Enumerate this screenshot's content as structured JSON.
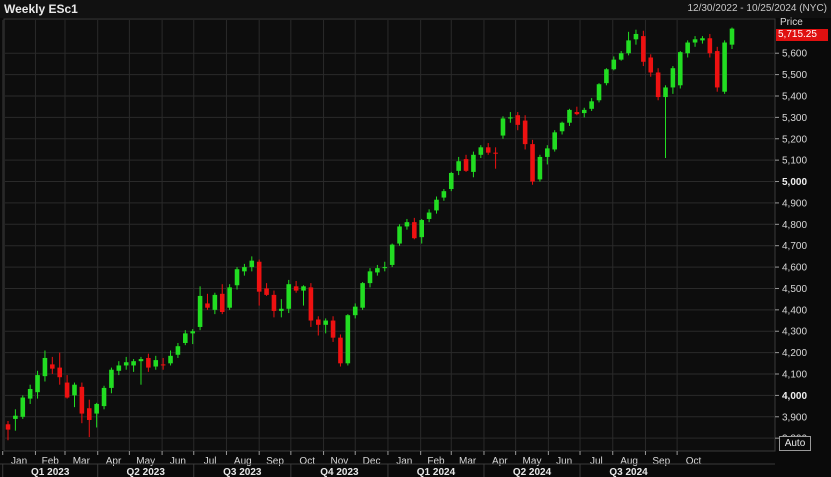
{
  "header": {
    "title": "Weekly ESc1",
    "date_range": "12/30/2022 - 10/25/2024 (NYC)"
  },
  "price_axis": {
    "label": "Price",
    "last_price": "5,715.25",
    "auto_label": "Auto"
  },
  "colors": {
    "up": "#22dd22",
    "down": "#ee1111",
    "background": "#0a0a0a",
    "grid": "#2a2a2a",
    "last_price_bg": "#e01010"
  },
  "chart_data": {
    "type": "candlestick",
    "title": "Weekly ESc1",
    "x_range": [
      "2022-12-30",
      "2024-10-25"
    ],
    "ylim": [
      3740,
      5760
    ],
    "y_ticks": [
      3800,
      3900,
      4000,
      4100,
      4200,
      4300,
      4400,
      4500,
      4600,
      4700,
      4800,
      4900,
      5000,
      5100,
      5200,
      5300,
      5400,
      5500,
      5600
    ],
    "y_tick_labels": [
      "3,800",
      "3,900",
      "4,000",
      "4,100",
      "4,200",
      "4,300",
      "4,400",
      "4,500",
      "4,600",
      "4,700",
      "4,800",
      "4,900",
      "5,000",
      "5,100",
      "5,200",
      "5,300",
      "5,400",
      "5,500",
      "5,600"
    ],
    "y_tick_labels_bold": [
      "4,000",
      "5,000"
    ],
    "grid": true,
    "month_labels": [
      "Jan",
      "Feb",
      "Mar",
      "Apr",
      "May",
      "Jun",
      "Jul",
      "Aug",
      "Sep",
      "Oct",
      "Nov",
      "Dec",
      "Jan",
      "Feb",
      "Mar",
      "Apr",
      "May",
      "Jun",
      "Jul",
      "Aug",
      "Sep",
      "Oct"
    ],
    "quarter_labels": [
      "Q1 2023",
      "Q2 2023",
      "Q3 2023",
      "Q4 2023",
      "Q1 2024",
      "Q2 2024",
      "Q3 2024"
    ],
    "candles": [
      {
        "week": "2023-01-06",
        "open": 3865,
        "high": 3880,
        "low": 3790,
        "close": 3840
      },
      {
        "week": "2023-01-13",
        "open": 3890,
        "high": 3935,
        "low": 3835,
        "close": 3905
      },
      {
        "week": "2023-01-20",
        "open": 3900,
        "high": 4000,
        "low": 3890,
        "close": 3990
      },
      {
        "week": "2023-01-27",
        "open": 3985,
        "high": 4050,
        "low": 3960,
        "close": 4030
      },
      {
        "week": "2023-02-03",
        "open": 4015,
        "high": 4115,
        "low": 3985,
        "close": 4095
      },
      {
        "week": "2023-02-10",
        "open": 4090,
        "high": 4210,
        "low": 4065,
        "close": 4175
      },
      {
        "week": "2023-02-17",
        "open": 4145,
        "high": 4180,
        "low": 4100,
        "close": 4125
      },
      {
        "week": "2023-02-24",
        "open": 4130,
        "high": 4200,
        "low": 4050,
        "close": 4085
      },
      {
        "week": "2023-03-03",
        "open": 4060,
        "high": 4095,
        "low": 3985,
        "close": 3990
      },
      {
        "week": "2023-03-10",
        "open": 4000,
        "high": 4060,
        "low": 3945,
        "close": 4050
      },
      {
        "week": "2023-03-17",
        "open": 4040,
        "high": 4060,
        "low": 3870,
        "close": 3915
      },
      {
        "week": "2023-03-24",
        "open": 3940,
        "high": 3980,
        "low": 3805,
        "close": 3885
      },
      {
        "week": "2023-03-31",
        "open": 3915,
        "high": 3965,
        "low": 3850,
        "close": 3960
      },
      {
        "week": "2023-04-07",
        "open": 3950,
        "high": 4045,
        "low": 3935,
        "close": 4035
      },
      {
        "week": "2023-04-14",
        "open": 4035,
        "high": 4130,
        "low": 4010,
        "close": 4120
      },
      {
        "week": "2023-04-21",
        "open": 4115,
        "high": 4160,
        "low": 4095,
        "close": 4140
      },
      {
        "week": "2023-04-28",
        "open": 4140,
        "high": 4180,
        "low": 4120,
        "close": 4155
      },
      {
        "week": "2023-05-05",
        "open": 4140,
        "high": 4170,
        "low": 4110,
        "close": 4160
      },
      {
        "week": "2023-05-12",
        "open": 4160,
        "high": 4180,
        "low": 4050,
        "close": 4170
      },
      {
        "week": "2023-05-19",
        "open": 4175,
        "high": 4195,
        "low": 4110,
        "close": 4130
      },
      {
        "week": "2023-05-26",
        "open": 4135,
        "high": 4185,
        "low": 4120,
        "close": 4165
      },
      {
        "week": "2023-06-02",
        "open": 4145,
        "high": 4175,
        "low": 4120,
        "close": 4140
      },
      {
        "week": "2023-06-09",
        "open": 4150,
        "high": 4210,
        "low": 4140,
        "close": 4185
      },
      {
        "week": "2023-06-16",
        "open": 4190,
        "high": 4245,
        "low": 4175,
        "close": 4230
      },
      {
        "week": "2023-06-23",
        "open": 4245,
        "high": 4305,
        "low": 4235,
        "close": 4290
      },
      {
        "week": "2023-06-30",
        "open": 4290,
        "high": 4310,
        "low": 4240,
        "close": 4300
      },
      {
        "week": "2023-07-07",
        "open": 4320,
        "high": 4510,
        "low": 4305,
        "close": 4465
      },
      {
        "week": "2023-07-14",
        "open": 4430,
        "high": 4475,
        "low": 4400,
        "close": 4410
      },
      {
        "week": "2023-07-21",
        "open": 4400,
        "high": 4480,
        "low": 4380,
        "close": 4470
      },
      {
        "week": "2023-07-28",
        "open": 4475,
        "high": 4520,
        "low": 4380,
        "close": 4390
      },
      {
        "week": "2023-08-04",
        "open": 4410,
        "high": 4520,
        "low": 4400,
        "close": 4505
      },
      {
        "week": "2023-08-11",
        "open": 4515,
        "high": 4600,
        "low": 4495,
        "close": 4590
      },
      {
        "week": "2023-08-18",
        "open": 4580,
        "high": 4615,
        "low": 4560,
        "close": 4600
      },
      {
        "week": "2023-08-25",
        "open": 4600,
        "high": 4650,
        "low": 4580,
        "close": 4630
      },
      {
        "week": "2023-09-01",
        "open": 4625,
        "high": 4635,
        "low": 4420,
        "close": 4485
      },
      {
        "week": "2023-09-08",
        "open": 4500,
        "high": 4525,
        "low": 4465,
        "close": 4470
      },
      {
        "week": "2023-09-15",
        "open": 4470,
        "high": 4490,
        "low": 4365,
        "close": 4395
      },
      {
        "week": "2023-09-22",
        "open": 4395,
        "high": 4450,
        "low": 4365,
        "close": 4405
      },
      {
        "week": "2023-09-29",
        "open": 4405,
        "high": 4540,
        "low": 4385,
        "close": 4520
      },
      {
        "week": "2023-10-06",
        "open": 4510,
        "high": 4535,
        "low": 4480,
        "close": 4490
      },
      {
        "week": "2023-10-13",
        "open": 4490,
        "high": 4515,
        "low": 4420,
        "close": 4510
      },
      {
        "week": "2023-10-20",
        "open": 4505,
        "high": 4525,
        "low": 4320,
        "close": 4350
      },
      {
        "week": "2023-10-27",
        "open": 4355,
        "high": 4370,
        "low": 4280,
        "close": 4330
      },
      {
        "week": "2023-11-03",
        "open": 4330,
        "high": 4360,
        "low": 4290,
        "close": 4350
      },
      {
        "week": "2023-11-10",
        "open": 4350,
        "high": 4370,
        "low": 4250,
        "close": 4270
      },
      {
        "week": "2023-11-17",
        "open": 4270,
        "high": 4285,
        "low": 4135,
        "close": 4150
      },
      {
        "week": "2023-11-24",
        "open": 4150,
        "high": 4380,
        "low": 4140,
        "close": 4375
      },
      {
        "week": "2023-12-01",
        "open": 4375,
        "high": 4430,
        "low": 4360,
        "close": 4415
      },
      {
        "week": "2023-12-08",
        "open": 4410,
        "high": 4530,
        "low": 4400,
        "close": 4525
      },
      {
        "week": "2023-12-15",
        "open": 4525,
        "high": 4595,
        "low": 4505,
        "close": 4580
      },
      {
        "week": "2023-12-22",
        "open": 4575,
        "high": 4610,
        "low": 4560,
        "close": 4595
      },
      {
        "week": "2023-12-29",
        "open": 4595,
        "high": 4625,
        "low": 4580,
        "close": 4600
      },
      {
        "week": "2024-01-05",
        "open": 4610,
        "high": 4710,
        "low": 4600,
        "close": 4705
      },
      {
        "week": "2024-01-12",
        "open": 4710,
        "high": 4800,
        "low": 4700,
        "close": 4790
      },
      {
        "week": "2024-01-19",
        "open": 4790,
        "high": 4825,
        "low": 4775,
        "close": 4810
      },
      {
        "week": "2024-01-26",
        "open": 4810,
        "high": 4830,
        "low": 4730,
        "close": 4735
      },
      {
        "week": "2024-02-02",
        "open": 4740,
        "high": 4825,
        "low": 4710,
        "close": 4820
      },
      {
        "week": "2024-02-09",
        "open": 4825,
        "high": 4870,
        "low": 4810,
        "close": 4855
      },
      {
        "week": "2024-02-16",
        "open": 4865,
        "high": 4930,
        "low": 4850,
        "close": 4915
      },
      {
        "week": "2024-02-23",
        "open": 4925,
        "high": 4965,
        "low": 4910,
        "close": 4955
      },
      {
        "week": "2024-03-01",
        "open": 4965,
        "high": 5045,
        "low": 4955,
        "close": 5040
      },
      {
        "week": "2024-03-08",
        "open": 5050,
        "high": 5115,
        "low": 5030,
        "close": 5095
      },
      {
        "week": "2024-03-15",
        "open": 5105,
        "high": 5125,
        "low": 5045,
        "close": 5050
      },
      {
        "week": "2024-03-22",
        "open": 5045,
        "high": 5140,
        "low": 5020,
        "close": 5125
      },
      {
        "week": "2024-03-29",
        "open": 5125,
        "high": 5170,
        "low": 5110,
        "close": 5160
      },
      {
        "week": "2024-04-05",
        "open": 5160,
        "high": 5180,
        "low": 5125,
        "close": 5135
      },
      {
        "week": "2024-04-12",
        "open": 5135,
        "high": 5160,
        "low": 5060,
        "close": 5130
      },
      {
        "week": "2024-04-19",
        "open": 5215,
        "high": 5305,
        "low": 5200,
        "close": 5295
      },
      {
        "week": "2024-04-26",
        "open": 5295,
        "high": 5325,
        "low": 5275,
        "close": 5300
      },
      {
        "week": "2024-05-03",
        "open": 5310,
        "high": 5325,
        "low": 5240,
        "close": 5265
      },
      {
        "week": "2024-05-10",
        "open": 5285,
        "high": 5310,
        "low": 5150,
        "close": 5175
      },
      {
        "week": "2024-05-17",
        "open": 5175,
        "high": 5195,
        "low": 4985,
        "close": 5000
      },
      {
        "week": "2024-05-24",
        "open": 5010,
        "high": 5125,
        "low": 5000,
        "close": 5115
      },
      {
        "week": "2024-05-31",
        "open": 5115,
        "high": 5170,
        "low": 5080,
        "close": 5155
      },
      {
        "week": "2024-06-07",
        "open": 5150,
        "high": 5240,
        "low": 5140,
        "close": 5230
      },
      {
        "week": "2024-06-14",
        "open": 5235,
        "high": 5280,
        "low": 5220,
        "close": 5275
      },
      {
        "week": "2024-06-21",
        "open": 5275,
        "high": 5340,
        "low": 5260,
        "close": 5335
      },
      {
        "week": "2024-06-28",
        "open": 5325,
        "high": 5350,
        "low": 5310,
        "close": 5315
      },
      {
        "week": "2024-07-05",
        "open": 5320,
        "high": 5345,
        "low": 5300,
        "close": 5335
      },
      {
        "week": "2024-07-12",
        "open": 5340,
        "high": 5390,
        "low": 5330,
        "close": 5375
      },
      {
        "week": "2024-07-19",
        "open": 5380,
        "high": 5460,
        "low": 5370,
        "close": 5455
      },
      {
        "week": "2024-07-26",
        "open": 5460,
        "high": 5530,
        "low": 5450,
        "close": 5525
      },
      {
        "week": "2024-08-02",
        "open": 5525,
        "high": 5585,
        "low": 5520,
        "close": 5570
      },
      {
        "week": "2024-08-09",
        "open": 5570,
        "high": 5610,
        "low": 5565,
        "close": 5600
      },
      {
        "week": "2024-08-16",
        "open": 5600,
        "high": 5700,
        "low": 5590,
        "close": 5660
      },
      {
        "week": "2024-08-23",
        "open": 5665,
        "high": 5710,
        "low": 5640,
        "close": 5690
      },
      {
        "week": "2024-08-30",
        "open": 5680,
        "high": 5705,
        "low": 5540,
        "close": 5560
      },
      {
        "week": "2024-09-06",
        "open": 5580,
        "high": 5595,
        "low": 5490,
        "close": 5510
      },
      {
        "week": "2024-09-13",
        "open": 5510,
        "high": 5530,
        "low": 5380,
        "close": 5395
      },
      {
        "week": "2024-09-20",
        "open": 5395,
        "high": 5450,
        "low": 5110,
        "close": 5440
      },
      {
        "week": "2024-09-27",
        "open": 5440,
        "high": 5540,
        "low": 5410,
        "close": 5530
      },
      {
        "week": "2024-10-04",
        "open": 5450,
        "high": 5610,
        "low": 5435,
        "close": 5605
      },
      {
        "week": "2024-10-11",
        "open": 5600,
        "high": 5660,
        "low": 5580,
        "close": 5650
      },
      {
        "week": "2024-10-18",
        "open": 5650,
        "high": 5680,
        "low": 5630,
        "close": 5665
      },
      {
        "week": "2024-10-25",
        "open": 5660,
        "high": 5680,
        "low": 5645,
        "close": 5670
      },
      {
        "week": "2024-11-01",
        "open": 5670,
        "high": 5690,
        "low": 5580,
        "close": 5600
      },
      {
        "week": "2024-11-08",
        "open": 5610,
        "high": 5630,
        "low": 5420,
        "close": 5440
      },
      {
        "week": "2024-11-15",
        "open": 5420,
        "high": 5660,
        "low": 5410,
        "close": 5650
      },
      {
        "week": "2024-11-22",
        "open": 5640,
        "high": 5720,
        "low": 5620,
        "close": 5715
      }
    ]
  }
}
